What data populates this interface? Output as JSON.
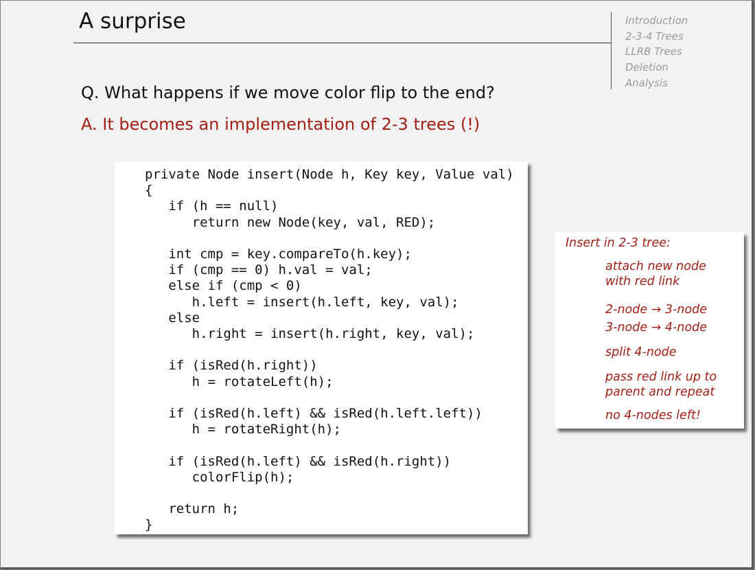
{
  "slide": {
    "title": "A surprise",
    "question": "Q. What happens if we move color flip to the end?",
    "answer": "A. It becomes an implementation of 2-3 trees (!)"
  },
  "nav": {
    "items": [
      "Introduction",
      "2-3-4 Trees",
      "LLRB Trees",
      "Deletion",
      "Analysis"
    ]
  },
  "code": {
    "text": "private Node insert(Node h, Key key, Value val)\n{\n   if (h == null)\n      return new Node(key, val, RED);\n\n   int cmp = key.compareTo(h.key);\n   if (cmp == 0) h.val = val;\n   else if (cmp < 0)\n      h.left = insert(h.left, key, val);\n   else\n      h.right = insert(h.right, key, val);\n\n   if (isRed(h.right))\n      h = rotateLeft(h);\n\n   if (isRed(h.left) && isRed(h.left.left))\n      h = rotateRight(h);\n\n   if (isRed(h.left) && isRed(h.right))\n      colorFlip(h);\n\n   return h;\n}"
  },
  "note": {
    "title": "Insert in 2-3 tree:",
    "items": [
      "attach new node\nwith red link",
      "2-node → 3-node\n3-node → 4-node",
      "split 4-node",
      "pass red link up to\nparent and repeat",
      "no 4-nodes left!"
    ]
  },
  "colors": {
    "accent_red": "#a31f14",
    "nav_gray": "#9a9a9a"
  }
}
